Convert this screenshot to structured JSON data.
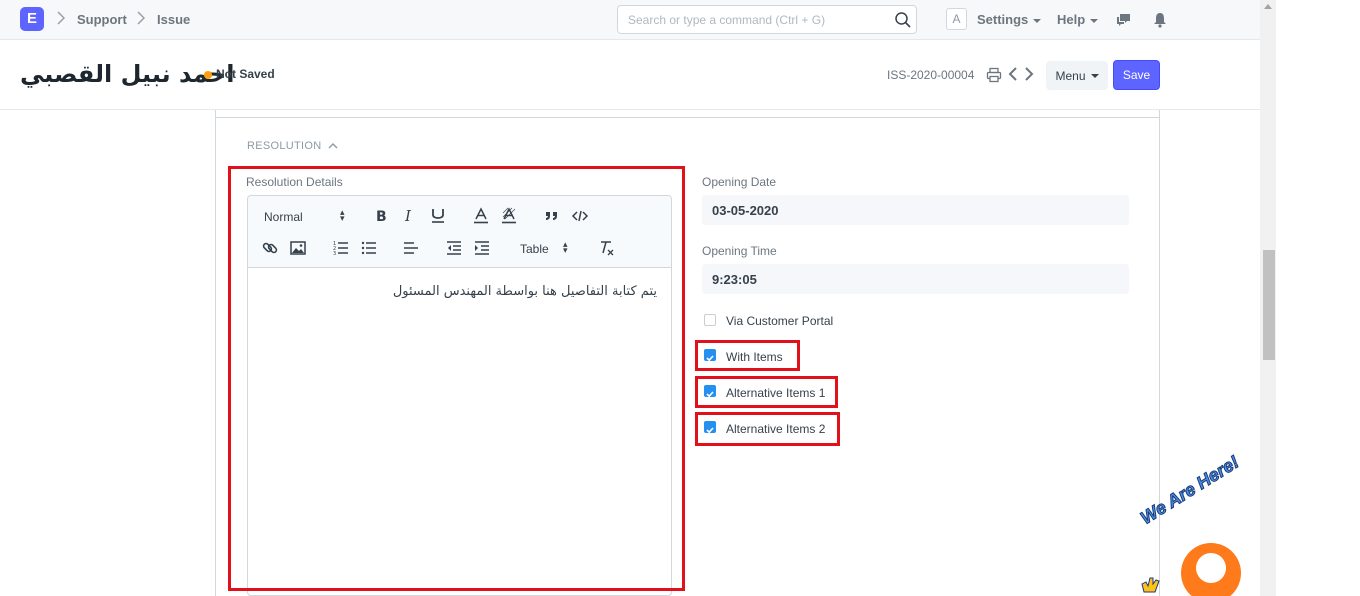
{
  "navbar": {
    "logo_letter": "E",
    "breadcrumbs": [
      "Support",
      "Issue"
    ],
    "search_placeholder": "Search or type a command (Ctrl + G)",
    "avatar_letter": "A",
    "settings_label": "Settings",
    "help_label": "Help"
  },
  "page_head": {
    "title": "احمد نبيل القصبي",
    "status": "Not Saved",
    "doc_name": "ISS-2020-00004",
    "menu_label": "Menu",
    "save_label": "Save"
  },
  "section": {
    "title": "RESOLUTION"
  },
  "resolution": {
    "label": "Resolution Details",
    "toolbar": {
      "format_value": "Normal",
      "table_label": "Table"
    },
    "content": "يتم كتابة التفاصيل هنا بواسطة المهندس المسئول"
  },
  "fields": {
    "opening_date_label": "Opening Date",
    "opening_date_value": "03-05-2020",
    "opening_time_label": "Opening Time",
    "opening_time_value": "9:23:05"
  },
  "checkboxes": [
    {
      "label": "Via Customer Portal",
      "checked": false
    },
    {
      "label": "With Items",
      "checked": true
    },
    {
      "label": "Alternative Items 1",
      "checked": true
    },
    {
      "label": "Alternative Items 2",
      "checked": true
    }
  ],
  "chat_widget": {
    "badge_text": "We Are Here!"
  },
  "colors": {
    "primary": "#5e64ff",
    "status_dot": "#ffa00a",
    "checkbox_checked": "#2490ef",
    "highlight": "#e1111c",
    "chat": "#ff7a1a"
  }
}
